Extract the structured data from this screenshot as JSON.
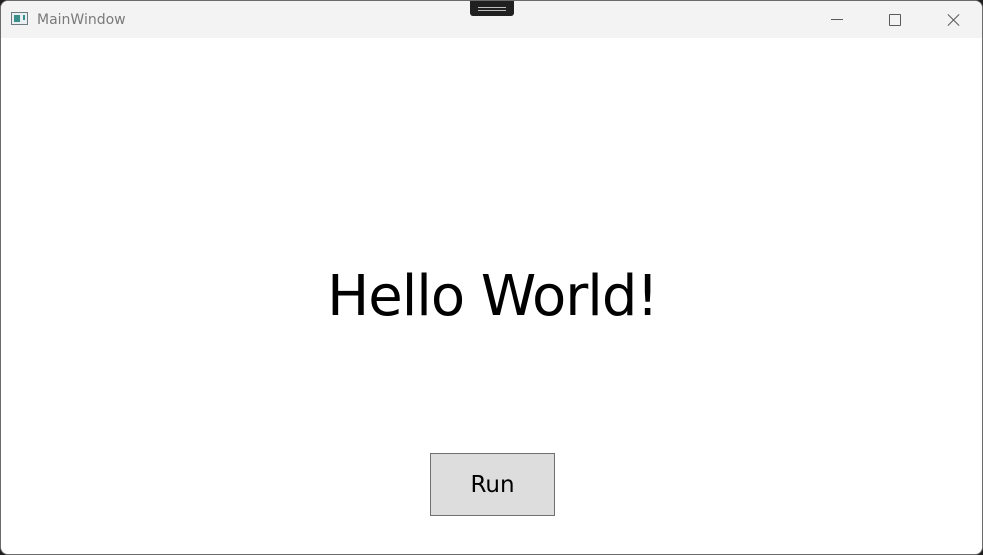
{
  "window": {
    "title": "MainWindow"
  },
  "icons": {
    "app": "app-window-icon",
    "snap": "snap-layout-handle-icon",
    "minimize": "minimize-icon",
    "maximize": "maximize-icon",
    "close": "close-icon"
  },
  "main": {
    "greeting": "Hello World!",
    "run_label": "Run"
  },
  "colors": {
    "titlebar_background": "#f3f3f3",
    "content_background": "#ffffff",
    "button_background": "#dddddd",
    "button_border": "#707070"
  }
}
